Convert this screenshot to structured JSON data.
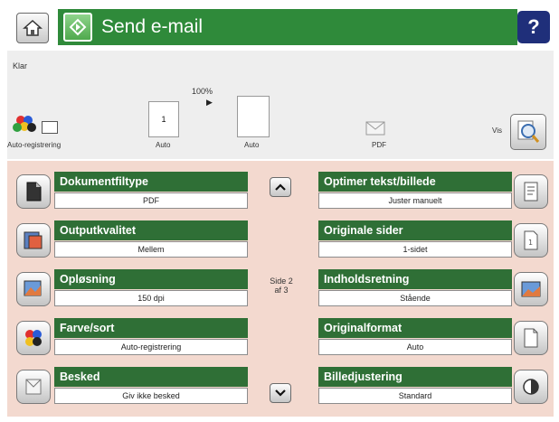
{
  "header": {
    "title": "Send e-mail",
    "help": "?"
  },
  "status": {
    "state": "Klar",
    "zoom": "100%",
    "color_mode_label": "Auto-registrering",
    "copies_value": "1",
    "copies_label": "Auto",
    "page_label": "Auto",
    "format_label": "PDF",
    "preview_label": "Vis"
  },
  "navigation": {
    "page_line1": "Side 2",
    "page_line2": "af 3"
  },
  "settings_left": [
    {
      "label": "Dokumentfiltype",
      "value": "PDF"
    },
    {
      "label": "Outputkvalitet",
      "value": "Mellem"
    },
    {
      "label": "Opløsning",
      "value": "150 dpi"
    },
    {
      "label": "Farve/sort",
      "value": "Auto-registrering"
    },
    {
      "label": "Besked",
      "value": "Giv ikke besked"
    }
  ],
  "settings_right": [
    {
      "label": "Optimer tekst/billede",
      "value": "Juster manuelt"
    },
    {
      "label": "Originale sider",
      "value": "1-sidet"
    },
    {
      "label": "Indholdsretning",
      "value": "Stående"
    },
    {
      "label": "Originalformat",
      "value": "Auto"
    },
    {
      "label": "Billedjustering",
      "value": "Standard"
    }
  ],
  "colors": {
    "title_bar": "#2f8a3a",
    "label_bar": "#2f6f36",
    "panel_bg": "#f3d9cf",
    "help_bg": "#1f2f7a"
  }
}
